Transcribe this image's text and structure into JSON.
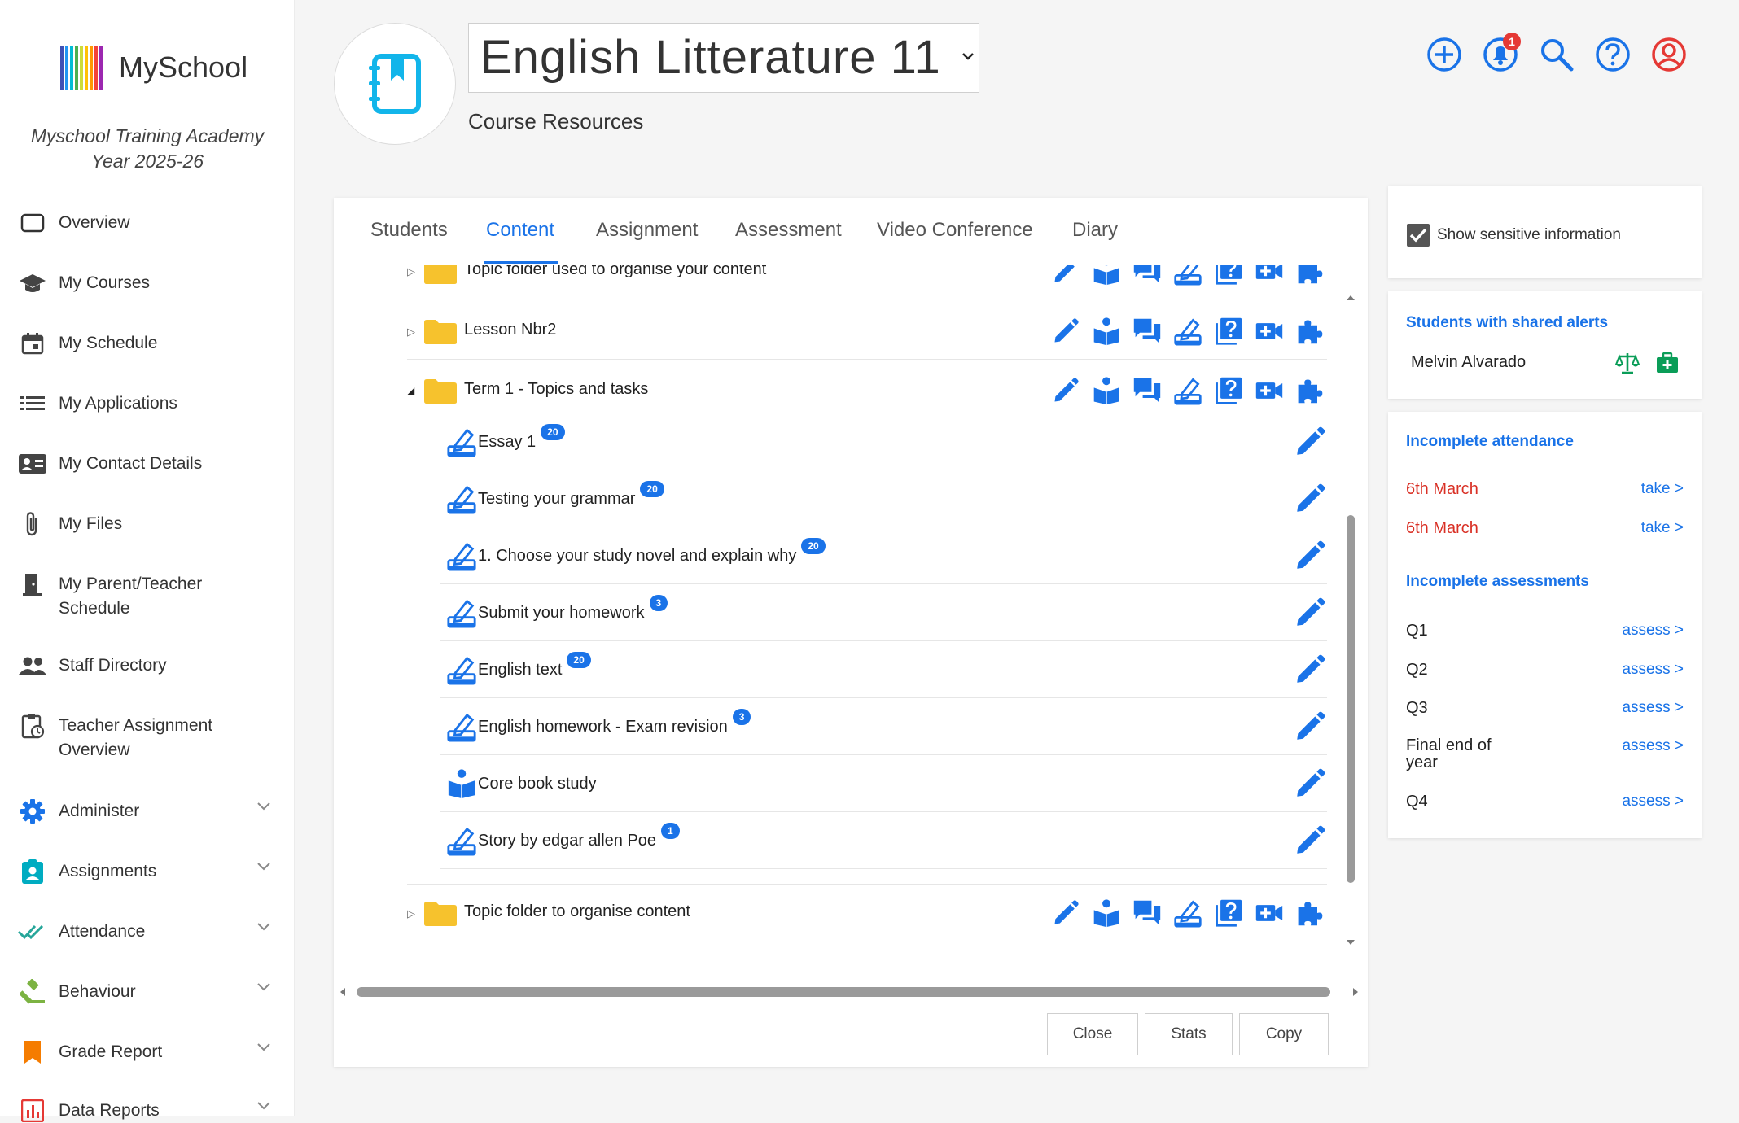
{
  "brand": {
    "name": "MySchool",
    "school": "Myschool Training Academy",
    "year": "Year 2025-26"
  },
  "nav": {
    "overview": "Overview",
    "courses": "My Courses",
    "schedule": "My Schedule",
    "applications": "My Applications",
    "contact": "My Contact Details",
    "files": "My Files",
    "parent_teacher": "My Parent/Teacher Schedule",
    "staff": "Staff Directory",
    "teacher_assign": "Teacher Assignment Overview",
    "administer": "Administer",
    "assignments": "Assignments",
    "attendance": "Attendance",
    "behaviour": "Behaviour",
    "grade_report": "Grade Report",
    "data_reports": "Data Reports"
  },
  "header": {
    "course_title": "English Litterature 11",
    "subtitle": "Course Resources",
    "notification_count": "1"
  },
  "tabs": [
    "Students",
    "Content",
    "Assignment",
    "Assessment",
    "Video Conference",
    "Diary"
  ],
  "tree": {
    "folder_partial": "Topic folder used to organise your content",
    "folder_lesson": "Lesson Nbr2",
    "folder_term": "Term 1 - Topics and tasks",
    "items": [
      {
        "name": "Essay 1",
        "badge": "20"
      },
      {
        "name": "Testing your grammar",
        "badge": "20"
      },
      {
        "name": "1. Choose your study novel and explain why",
        "badge": "20"
      },
      {
        "name": "Submit your homework",
        "badge": "3"
      },
      {
        "name": "English text",
        "badge": "20"
      },
      {
        "name": "English homework - Exam revision",
        "badge": "3"
      },
      {
        "name": "Core book study",
        "badge": ""
      },
      {
        "name": "Story by edgar allen Poe",
        "badge": "1"
      }
    ],
    "folder_last": "Topic folder to organise content"
  },
  "buttons": {
    "close": "Close",
    "stats": "Stats",
    "copy": "Copy"
  },
  "right": {
    "sensitive": "Show sensitive information",
    "alerts_title": "Students with shared alerts",
    "alert_student": "Melvin Alvarado",
    "attendance_title": "Incomplete attendance",
    "attendance": [
      {
        "date": "6th March",
        "action": "take >"
      },
      {
        "date": "6th March",
        "action": "take >"
      }
    ],
    "assess_title": "Incomplete assessments",
    "assessments": [
      {
        "name": "Q1",
        "action": "assess >"
      },
      {
        "name": "Q2",
        "action": "assess >"
      },
      {
        "name": "Q3",
        "action": "assess >"
      },
      {
        "name": "Final end of year",
        "action": "assess >"
      },
      {
        "name": "Q4",
        "action": "assess >"
      }
    ]
  },
  "colors": {
    "accent": "#1a73e8",
    "folder": "#f6c22d",
    "alert_red": "#d93025",
    "profile_red": "#e53935",
    "alert_green": "#0a9d58"
  }
}
